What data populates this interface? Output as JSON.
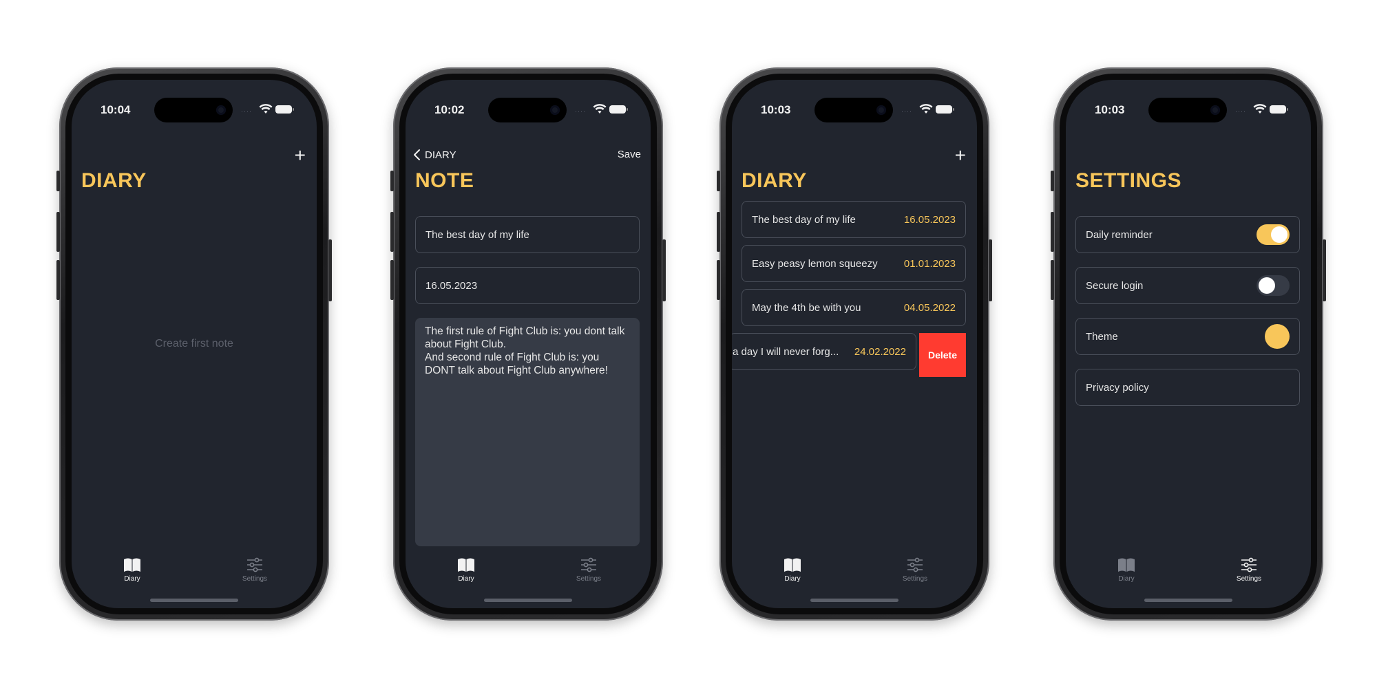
{
  "colors": {
    "accent": "#f8c65a",
    "background": "#21252e",
    "delete": "#ff3b30",
    "field_dark": "#363b46"
  },
  "tabs": {
    "diary_label": "Diary",
    "settings_label": "Settings"
  },
  "screens": [
    {
      "time": "10:04",
      "title": "DIARY",
      "empty_text": "Create first note",
      "active_tab": "diary"
    },
    {
      "time": "10:02",
      "back_label": "DIARY",
      "save_label": "Save",
      "title": "NOTE",
      "note_title": "The best day of my life",
      "note_date": "16.05.2023",
      "note_body": "The first rule of Fight Club is: you dont talk\nabout Fight Club.\nAnd second rule of Fight Club is: you\nDONT talk about Fight Club anywhere!",
      "active_tab": "diary"
    },
    {
      "time": "10:03",
      "title": "DIARY",
      "entries": [
        {
          "title": "The best day of my life",
          "date": "16.05.2023"
        },
        {
          "title": "Easy peasy lemon squeezy",
          "date": "01.01.2023"
        },
        {
          "title": "May the 4th be with you",
          "date": "04.05.2022"
        },
        {
          "title": "a day I will never forg...",
          "date": "24.02.2022"
        }
      ],
      "delete_label": "Delete",
      "active_tab": "diary"
    },
    {
      "time": "10:03",
      "title": "SETTINGS",
      "settings": [
        {
          "label": "Daily reminder",
          "control": "toggle",
          "value": true
        },
        {
          "label": "Secure login",
          "control": "toggle",
          "value": false
        },
        {
          "label": "Theme",
          "control": "color-dot"
        },
        {
          "label": "Privacy policy",
          "control": "none"
        }
      ],
      "active_tab": "settings"
    }
  ]
}
